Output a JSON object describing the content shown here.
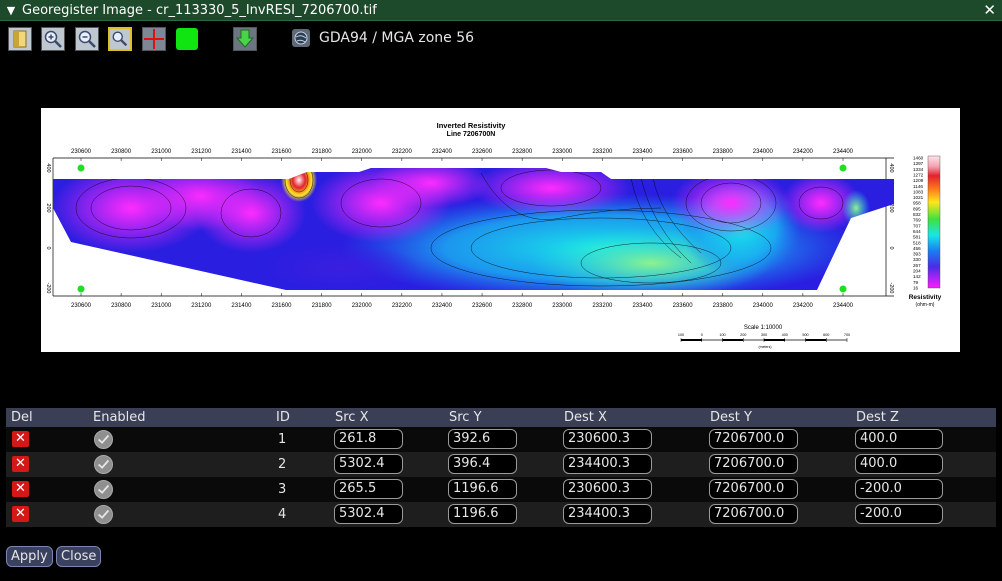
{
  "window": {
    "title": "Georegister Image - cr_113330_5_InvRESI_7206700.tif",
    "collapse_glyph": "▼",
    "close_glyph": "✕"
  },
  "toolbar": {
    "buttons": [
      "open-file-icon",
      "zoom-in-icon",
      "zoom-out-icon",
      "zoom-fit-icon",
      "add-point-icon",
      "color-swatch",
      "export-down-arrow-icon"
    ],
    "crs_label": "GDA94 / MGA zone 56",
    "color_swatch": "#11e511"
  },
  "image": {
    "title": "Inverted Resistivity",
    "subtitle": "Line 7206700N",
    "x_ticks": [
      "230600",
      "230800",
      "231000",
      "231200",
      "231400",
      "231600",
      "231800",
      "232000",
      "232200",
      "232400",
      "232600",
      "232800",
      "233000",
      "233200",
      "233400",
      "233600",
      "233800",
      "234000",
      "234200",
      "234400"
    ],
    "left_y_ticks": [
      "400",
      "200",
      "0",
      "-200"
    ],
    "right_y_ticks": [
      "400",
      "200",
      "0",
      "-200"
    ],
    "legend_values": [
      "1460",
      "1397",
      "1334",
      "1272",
      "1209",
      "1146",
      "1083",
      "1021",
      "958",
      "895",
      "832",
      "769",
      "707",
      "644",
      "581",
      "518",
      "456",
      "393",
      "330",
      "267",
      "204",
      "142",
      "79",
      "16"
    ],
    "legend_title": "Resistivity",
    "legend_unit": "(ohm-m)",
    "scale_label": "Scale 1:10000",
    "scale_ticks": [
      "100",
      "0",
      "100",
      "200",
      "300",
      "400",
      "500",
      "600",
      "700"
    ],
    "scale_unit": "(meters)"
  },
  "table": {
    "headers": {
      "del": "Del",
      "enabled": "Enabled",
      "id": "ID",
      "src_x": "Src X",
      "src_y": "Src Y",
      "dest_x": "Dest X",
      "dest_y": "Dest Y",
      "dest_z": "Dest Z"
    },
    "rows": [
      {
        "id": "1",
        "enabled": true,
        "src_x": "261.8",
        "src_y": "392.6",
        "dest_x": "230600.3",
        "dest_y": "7206700.0",
        "dest_z": "400.0"
      },
      {
        "id": "2",
        "enabled": true,
        "src_x": "5302.4",
        "src_y": "396.4",
        "dest_x": "234400.3",
        "dest_y": "7206700.0",
        "dest_z": "400.0"
      },
      {
        "id": "3",
        "enabled": true,
        "src_x": "265.5",
        "src_y": "1196.6",
        "dest_x": "230600.3",
        "dest_y": "7206700.0",
        "dest_z": "-200.0"
      },
      {
        "id": "4",
        "enabled": true,
        "src_x": "5302.4",
        "src_y": "1196.6",
        "dest_x": "234400.3",
        "dest_y": "7206700.0",
        "dest_z": "-200.0"
      }
    ]
  },
  "buttons": {
    "apply": "Apply",
    "close": "Close"
  }
}
